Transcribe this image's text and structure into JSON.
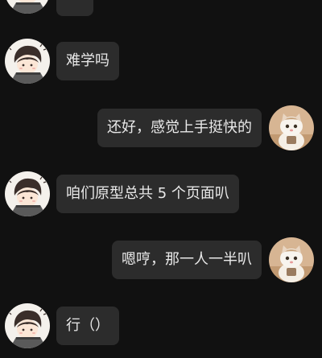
{
  "chat": {
    "messages": [
      {
        "side": "left",
        "avatar": "boy-avatar",
        "text": ""
      },
      {
        "side": "left",
        "avatar": "boy-avatar",
        "text": "难学吗"
      },
      {
        "side": "right",
        "avatar": "cat-avatar",
        "text": "还好，感觉上手挺快的"
      },
      {
        "side": "left",
        "avatar": "boy-avatar",
        "text": "咱们原型总共 5 个页面叭"
      },
      {
        "side": "right",
        "avatar": "cat-avatar",
        "text": "嗯哼，那一人一半叭"
      },
      {
        "side": "left",
        "avatar": "boy-avatar",
        "text": "行（）"
      }
    ]
  },
  "colors": {
    "background": "#111111",
    "bubble": "#2c2c2c",
    "text": "#e9e9e9"
  }
}
